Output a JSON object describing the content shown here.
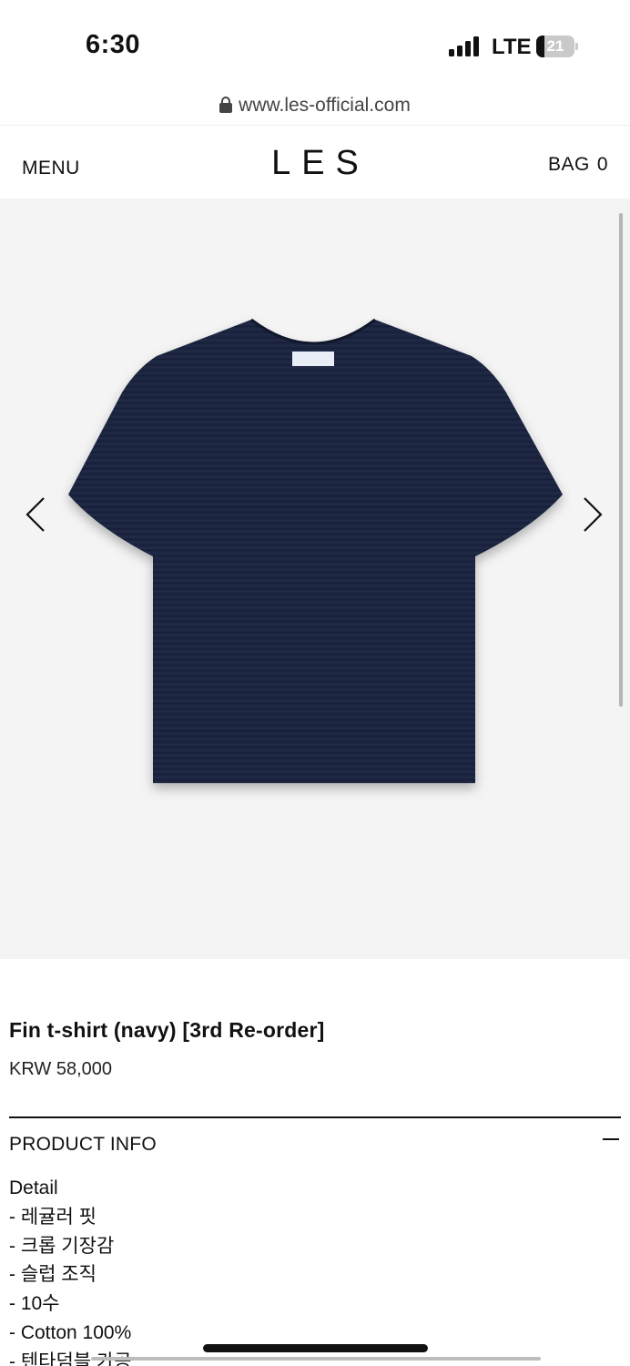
{
  "status_bar": {
    "time": "6:30",
    "network": "LTE",
    "battery": "21",
    "battery_percent": 21,
    "signal_icon": "signal-bars-icon"
  },
  "browser": {
    "url": "www.les-official.com",
    "lock_icon": "lock-icon"
  },
  "header": {
    "menu_label": "MENU",
    "logo": "LES",
    "bag_label": "BAG",
    "bag_count": "0"
  },
  "gallery": {
    "prev_icon": "chevron-left-icon",
    "next_icon": "chevron-right-icon",
    "background": "#f4f4f4",
    "shirt_color": "#1b2540"
  },
  "product": {
    "title": "Fin t-shirt (navy) [3rd Re-order]",
    "price": "KRW 58,000"
  },
  "product_info": {
    "heading": "PRODUCT INFO",
    "toggle_icon": "minus-icon",
    "detail_label": "Detail",
    "details": [
      "- 레귤러 핏",
      "- 크롭 기장감",
      "- 슬럽 조직",
      "- 10수",
      "- Cotton 100%",
      "- 텐타덤블 가공"
    ]
  }
}
